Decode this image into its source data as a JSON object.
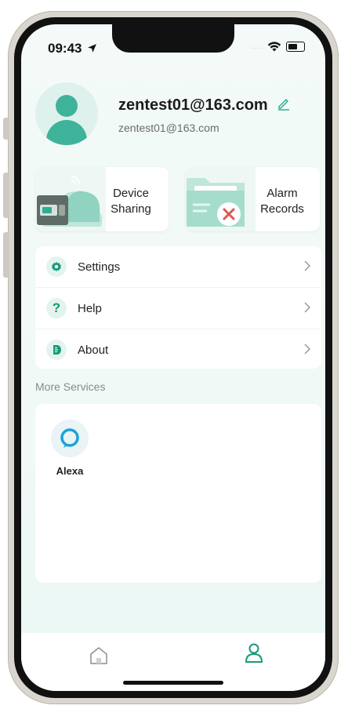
{
  "status_bar": {
    "time": "09:43",
    "signal_dots": "....",
    "icons": [
      "location-arrow-icon",
      "wifi-icon",
      "battery-icon"
    ]
  },
  "profile": {
    "username": "zentest01@163.com",
    "email": "zentest01@163.com"
  },
  "cards": [
    {
      "label_line1": "Device",
      "label_line2": "Sharing",
      "icon": "cloud-device-icon"
    },
    {
      "label_line1": "Alarm",
      "label_line2": "Records",
      "icon": "folder-alarm-icon"
    }
  ],
  "menu": [
    {
      "label": "Settings",
      "icon": "gear-icon"
    },
    {
      "label": "Help",
      "icon": "question-icon"
    },
    {
      "label": "About",
      "icon": "about-icon"
    }
  ],
  "more_services": {
    "title": "More Services",
    "items": [
      {
        "label": "Alexa",
        "icon": "alexa-icon"
      }
    ]
  },
  "tabbar": {
    "tabs": [
      {
        "name": "home",
        "icon": "home-icon",
        "active": false
      },
      {
        "name": "me",
        "icon": "user-icon",
        "active": true
      }
    ]
  },
  "colors": {
    "accent": "#159b79",
    "accent_light": "#e3f4ef",
    "background": "#f3faf8"
  }
}
